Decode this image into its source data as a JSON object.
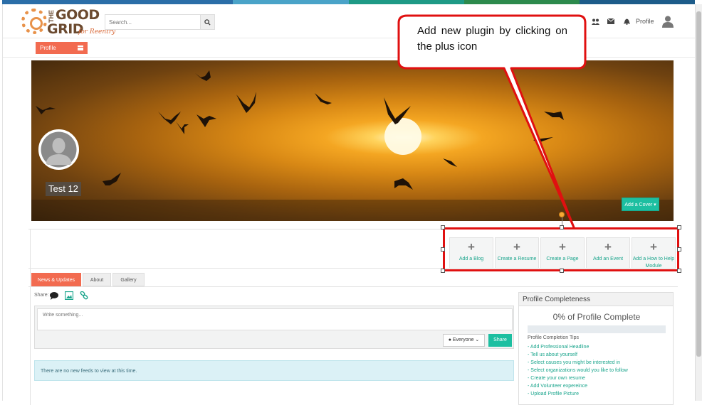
{
  "brand": {
    "logo_line1": "GOOD",
    "logo_line2": "GRID",
    "logo_prefix": "THE",
    "logo_tagline": "for Reentry"
  },
  "header": {
    "search_placeholder": "Search...",
    "profile_label": "Profile",
    "stripe_colors": [
      "#2b6ea8",
      "#2b6ea8",
      "#4aa3c8",
      "#1e9a86",
      "#2c8a4c",
      "#1d5c8a"
    ]
  },
  "subnav": {
    "profile_tab_label": "Profile"
  },
  "cover": {
    "user_name": "Test 12",
    "add_cover_label": "Add a Cover ▾"
  },
  "plugins": [
    {
      "label": "Add a Blog"
    },
    {
      "label": "Create a Resume"
    },
    {
      "label": "Create a Page"
    },
    {
      "label": "Add an Event"
    },
    {
      "label": "Add a How to Help Module"
    }
  ],
  "tabs": [
    {
      "label": "News & Updates",
      "active": true
    },
    {
      "label": "About",
      "active": false
    },
    {
      "label": "Gallery",
      "active": false
    }
  ],
  "feed": {
    "share_label": "Share:",
    "composer_placeholder": "Write something...",
    "audience_label": "Everyone",
    "share_button": "Share",
    "empty_message": "There are no new feeds to view at this time."
  },
  "completeness": {
    "heading": "Profile Completeness",
    "percent_text": "0% of Profile Complete",
    "percent_value": 0,
    "tips_title": "Profile Completion Tips",
    "tips": [
      "- Add Professional Headline",
      "- Tell us about yourself",
      "- Select causes you might be interested in",
      "- Select organizations would you like to follow",
      "- Create your own resume",
      "- Add Volunteer expereince",
      "- Upload Profile Picture"
    ]
  },
  "callout": {
    "text": "Add new plugin by clicking on the plus icon",
    "border_color": "#e01010"
  },
  "colors": {
    "accent_orange": "#f26b50",
    "accent_teal": "#1dbfa1"
  }
}
